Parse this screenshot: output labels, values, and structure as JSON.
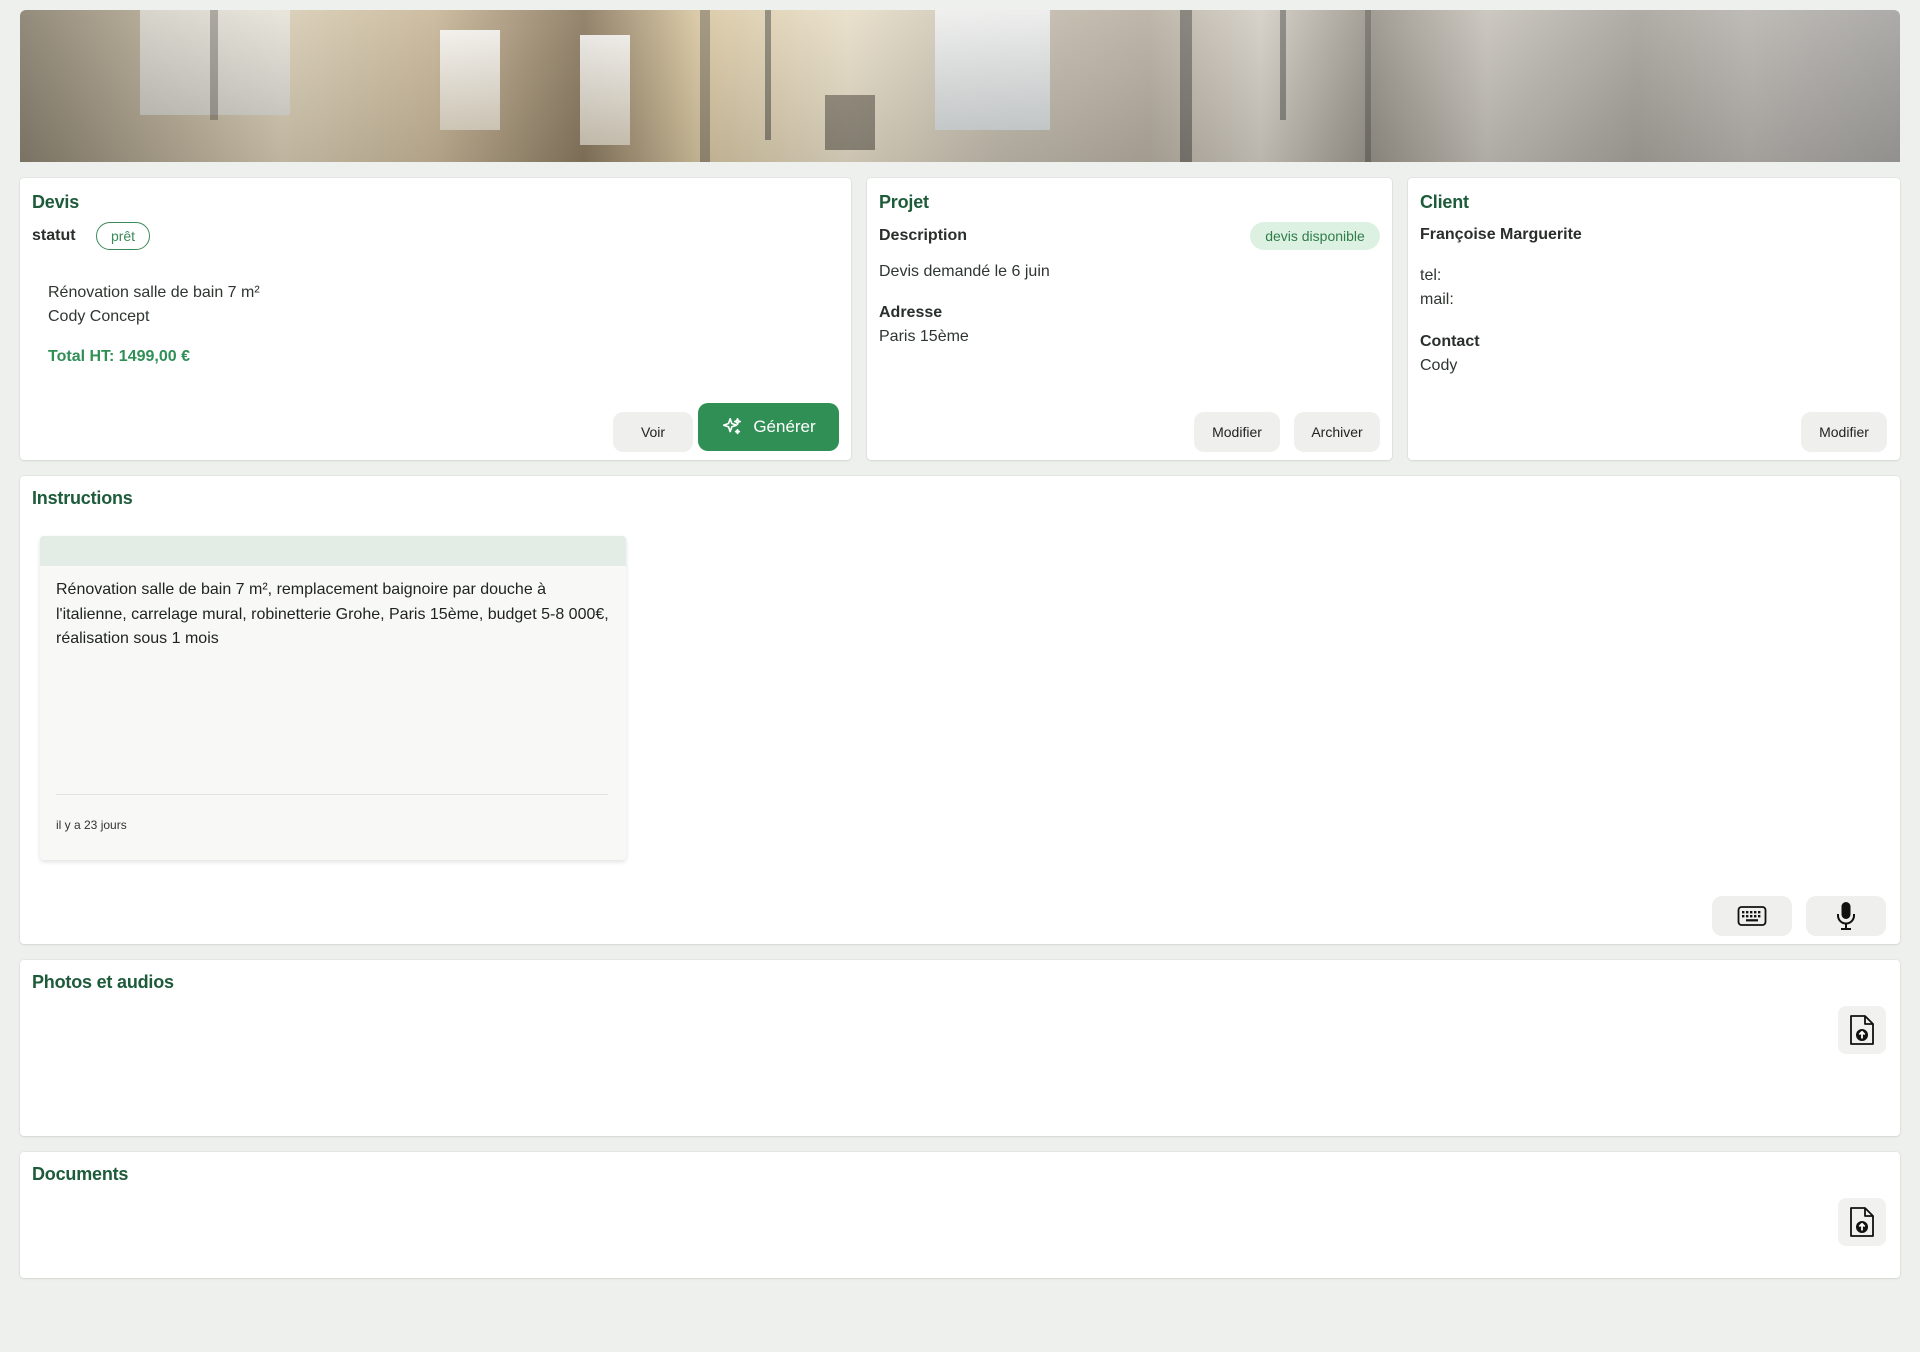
{
  "devis": {
    "title": "Devis",
    "status_label": "statut",
    "status_value": "prêt",
    "line1": "Rénovation salle de bain 7 m²",
    "line2": "Cody Concept",
    "total": "Total HT: 1499,00 €",
    "voir_button": "Voir",
    "generer_button": "Générer",
    "generer_icon": "sparkles-icon"
  },
  "projet": {
    "title": "Projet",
    "description_label": "Description",
    "badge": "devis disponible",
    "description_text": "Devis demandé le 6 juin",
    "adresse_label": "Adresse",
    "adresse_value": "Paris 15ème",
    "modifier_button": "Modifier",
    "archiver_button": "Archiver"
  },
  "client": {
    "title": "Client",
    "name": "Françoise Marguerite",
    "tel_label": "tel:",
    "mail_label": "mail:",
    "contact_label": "Contact",
    "contact_value": "Cody",
    "modifier_button": "Modifier"
  },
  "instructions": {
    "title": "Instructions",
    "note_text": "Rénovation salle de bain 7 m², remplacement baignoire par douche à l'italienne, carrelage mural, robinetterie Grohe, Paris 15ème, budget 5-8 000€, réalisation sous 1 mois",
    "note_time": "il y a 23 jours",
    "keyboard_icon": "keyboard-icon",
    "mic_icon": "microphone-icon"
  },
  "photos": {
    "title": "Photos et audios",
    "upload_icon": "file-upload-icon"
  },
  "documents": {
    "title": "Documents",
    "upload_icon": "file-upload-icon"
  },
  "colors": {
    "accent": "#2f8f55",
    "title_green": "#1e5b3a",
    "badge_bg": "#ddf1e2",
    "background": "#eef0ed"
  }
}
